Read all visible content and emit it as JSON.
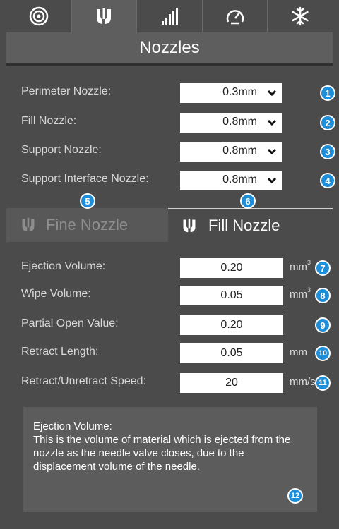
{
  "tabs": [
    {
      "icon": "spiral-icon",
      "active": false
    },
    {
      "icon": "nozzle-icon",
      "active": true
    },
    {
      "icon": "infill-bars-icon",
      "active": false
    },
    {
      "icon": "speedometer-icon",
      "active": false
    },
    {
      "icon": "snowflake-icon",
      "active": false
    }
  ],
  "section_title": "Nozzles",
  "nozzle_rows": [
    {
      "label": "Perimeter Nozzle:",
      "value": "0.3mm"
    },
    {
      "label": "Fill Nozzle:",
      "value": "0.8mm"
    },
    {
      "label": "Support Nozzle:",
      "value": "0.8mm"
    },
    {
      "label": "Support Interface Nozzle:",
      "value": "0.8mm"
    }
  ],
  "subtabs": {
    "fine_label": "Fine Nozzle",
    "fill_label": "Fill Nozzle",
    "active": "fill"
  },
  "settings_rows": [
    {
      "label": "Ejection Volume:",
      "value": "0.20",
      "unit": "mm",
      "unit_sup": "3"
    },
    {
      "label": "Wipe Volume:",
      "value": "0.05",
      "unit": "mm",
      "unit_sup": "3"
    },
    {
      "label": "Partial Open Value:",
      "value": "0.20",
      "unit": "",
      "unit_sup": ""
    },
    {
      "label": "Retract Length:",
      "value": "0.05",
      "unit": "mm",
      "unit_sup": ""
    },
    {
      "label": "Retract/Unretract Speed:",
      "value": "20",
      "unit": "mm/s",
      "unit_sup": ""
    }
  ],
  "help": {
    "title": "Ejection Volume:",
    "body": "This is the volume of material which is ejected from the nozzle as the needle valve closes, due to the displacement volume of the needle."
  },
  "badges": [
    "1",
    "2",
    "3",
    "4",
    "5",
    "6",
    "7",
    "8",
    "9",
    "10",
    "11",
    "12"
  ],
  "colors": {
    "badge": "#1f8ed8",
    "panel": "#4b4b4b",
    "header": "#5e5e5e"
  }
}
